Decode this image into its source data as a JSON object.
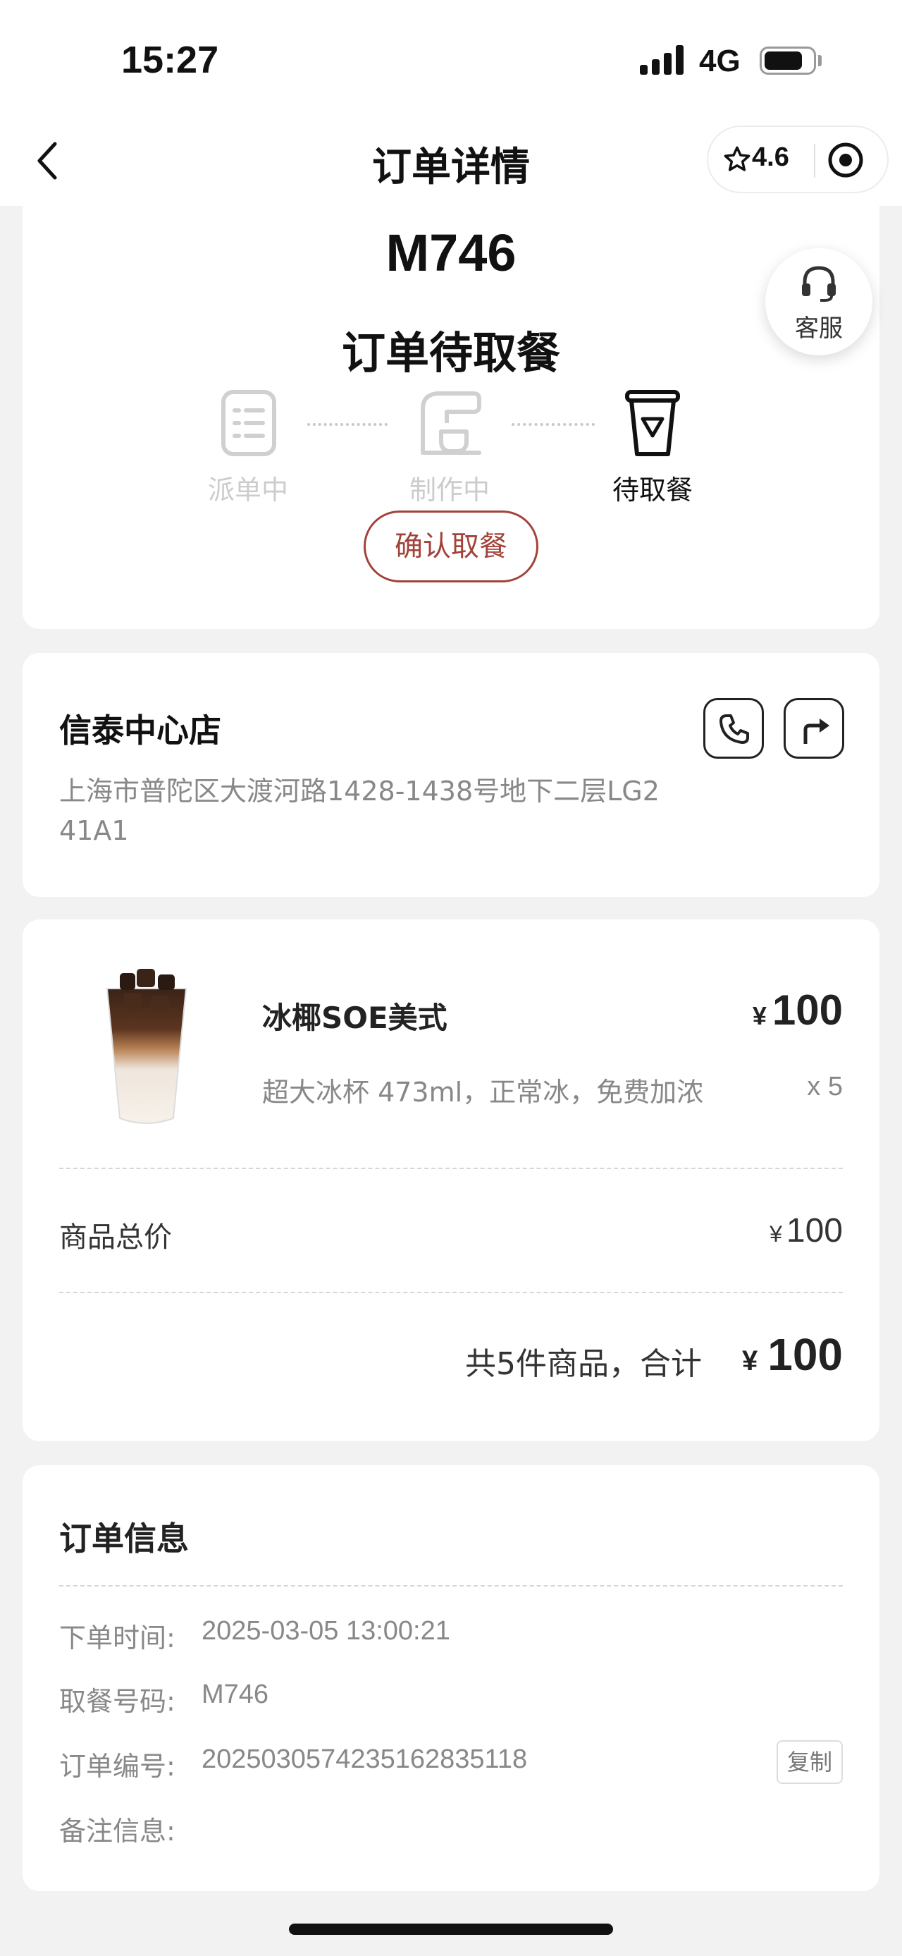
{
  "status_bar": {
    "time": "15:27",
    "network": "4G",
    "battery_percent": 80
  },
  "nav": {
    "title": "订单详情",
    "rating": "4.6"
  },
  "order_status": {
    "pickup_code": "M746",
    "title": "订单待取餐",
    "steps": [
      {
        "label": "派单中",
        "active": false
      },
      {
        "label": "制作中",
        "active": false
      },
      {
        "label": "待取餐",
        "active": true
      }
    ],
    "confirm_button": "确认取餐"
  },
  "service": {
    "label": "客服"
  },
  "store": {
    "name": "信泰中心店",
    "address": "上海市普陀区大渡河路1428-1438号地下二层LG2 41A1"
  },
  "items": [
    {
      "name": "冰椰SOE美式",
      "currency": "¥",
      "price": "100",
      "spec": "超大冰杯 473ml，正常冰，免费加浓",
      "quantity": "x 5"
    }
  ],
  "price_summary": {
    "subtotal_label": "商品总价",
    "currency": "¥",
    "subtotal_value": "100",
    "summary_text": "共5件商品，合计",
    "total": "100"
  },
  "order_info": {
    "title": "订单信息",
    "rows": [
      {
        "label": "下单时间:",
        "value": "2025-03-05 13:00:21"
      },
      {
        "label": "取餐号码:",
        "value": "M746"
      },
      {
        "label": "订单编号:",
        "value": "20250305742351628351​18"
      },
      {
        "label": "备注信息:",
        "value": ""
      }
    ],
    "copy_button": "复制"
  },
  "colors": {
    "accent": "#a2433a",
    "background": "#f2f2f2"
  }
}
